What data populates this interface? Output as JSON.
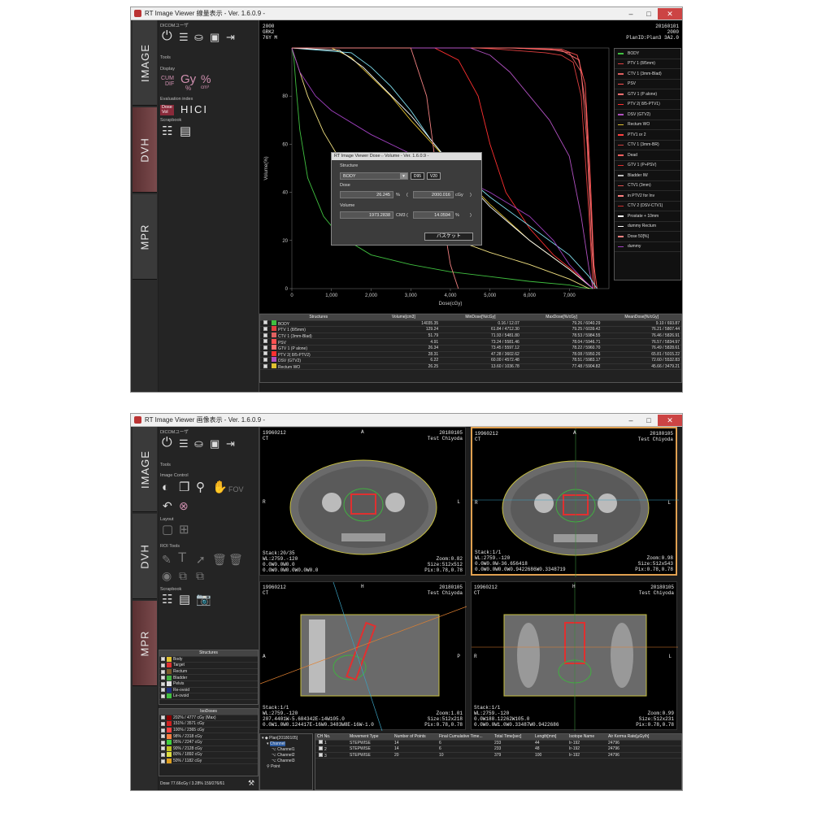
{
  "dvh_window": {
    "title": "RT Image Viewer  線量表示 - Ver. 1.6.0.9 -",
    "tabs": [
      "IMAGE",
      "DVH",
      "MPR"
    ],
    "user_label": "DICOMユーザ",
    "sections": {
      "tools": "Tools",
      "display": "Display",
      "evaluation": "Evaluation index",
      "scrapbook": "Scrapbook"
    },
    "display_icons": {
      "cum": "CUM",
      "dif": "DIF",
      "gy": "Gy",
      "pct": "%",
      "cm3": "cm³",
      "vol": "%"
    },
    "eval_icons": {
      "dose": "Dose",
      "vol": "Vol",
      "hi": "HI",
      "ci": "CI"
    },
    "chart_header": {
      "left": [
        "2000",
        "GRK2",
        "76Y M"
      ],
      "right": [
        "20160101",
        "2000",
        "PlanID:Plan3 3A2.0"
      ]
    },
    "legend": [
      {
        "name": "BODY",
        "color": "#40c040"
      },
      {
        "name": "PTV 1 (8/5mm)",
        "color": "#e04040"
      },
      {
        "name": "CTV 1 (3mm-Blad)",
        "color": "#e06060"
      },
      {
        "name": "PSV",
        "color": "#ff5050"
      },
      {
        "name": "GTV 1 (P alone)",
        "color": "#ff7070"
      },
      {
        "name": "PTV 2( 8/5-PTV1)",
        "color": "#ff3030"
      },
      {
        "name": "DSV (GTV2)",
        "color": "#b050c0"
      },
      {
        "name": "Rectum WO",
        "color": "#e0c030"
      },
      {
        "name": "PTV1 or 2",
        "color": "#ff4040"
      },
      {
        "name": "CTV 1 (3mm-BR)",
        "color": "#d04040"
      },
      {
        "name": "Dead",
        "color": "#ff6060"
      },
      {
        "name": "GTV 1 (P+PSV)",
        "color": "#e03030"
      },
      {
        "name": "Bladder IW",
        "color": "#c0c0c0"
      },
      {
        "name": "CTV1 (3mm)",
        "color": "#e05050"
      },
      {
        "name": "in PTV2 for Inv",
        "color": "#ff8080"
      },
      {
        "name": "CTV 2 (DSV-CTV1)",
        "color": "#d03030"
      },
      {
        "name": "Prostate + 10mm",
        "color": "#ffffff"
      },
      {
        "name": "dummy Rectum",
        "color": "#ffffff"
      },
      {
        "name": "Dose 50[%]",
        "color": "#f08080"
      },
      {
        "name": "dummy",
        "color": "#a040c0"
      }
    ],
    "dialog": {
      "title": "RT Image Viewer  Dose⇔Volume - Ver. 1.6.0.9 -",
      "structure_label": "Structure",
      "structure_value": "BODY",
      "btn_d95": "D95",
      "btn_v20": "V20",
      "dose_label": "Dose",
      "dose_pct": "26.245",
      "dose_pct_unit": "%",
      "dose_cgy": "2000.016",
      "dose_cgy_unit": "cGy",
      "volume_label": "Volume",
      "volume_cm3": "1973.2838",
      "volume_cm3_unit": "CM3",
      "volume_pct": "14.0594",
      "volume_pct_unit": "%",
      "basket_button": "バスケット"
    },
    "table": {
      "headers": [
        "Structures",
        "Volume[cm3]",
        "MinDose[%/cGy]",
        "MaxDose[%/cGy]",
        "MeanDose[%/cGy]"
      ],
      "rows": [
        {
          "name": "BODY",
          "color": "#40c040",
          "vol": "14035.35",
          "min": "0.16 / 12.07",
          "max": "79.26 / 6040.29",
          "mean": "9.10 / 693.87"
        },
        {
          "name": "PTV 1 (8/5mm)",
          "color": "#e04040",
          "vol": "129.24",
          "min": "61.84 / 4712.30",
          "max": "79.25 / 6039.42",
          "mean": "76.21 / 5807.44"
        },
        {
          "name": "CTV 1 (3mm-Blad)",
          "color": "#e06060",
          "vol": "51.79",
          "min": "71.93 / 5481.80",
          "max": "78.53 / 5984.55",
          "mean": "76.46 / 5826.91"
        },
        {
          "name": "PSV",
          "color": "#ff5050",
          "vol": "4.91",
          "min": "73.24 / 5581.46",
          "max": "78.04 / 5946.71",
          "mean": "76.57 / 5834.97"
        },
        {
          "name": "GTV 1 (P alone)",
          "color": "#ff7070",
          "vol": "26.34",
          "min": "73.45 / 5597.12",
          "max": "78.22 / 5960.70",
          "mean": "76.49 / 5828.61"
        },
        {
          "name": "PTV 2( 8/5-PTV2)",
          "color": "#ff3030",
          "vol": "28.31",
          "min": "47.28 / 3602.62",
          "max": "78.08 / 5950.26",
          "mean": "65.81 / 5015.22"
        },
        {
          "name": "DSV (GTV2)",
          "color": "#b050c0",
          "vol": "6.22",
          "min": "60.00 / 4572.48",
          "max": "78.51 / 5983.17",
          "mean": "72.60 / 5532.83"
        },
        {
          "name": "Rectum WO",
          "color": "#e0c030",
          "vol": "26.25",
          "min": "13.60 / 1036.78",
          "max": "77.48 / 5904.82",
          "mean": "45.66 / 3479.21"
        }
      ]
    },
    "chart_data": {
      "type": "line",
      "xlabel": "Dose(cGy)",
      "ylabel": "Volume(%)",
      "xlim": [
        0,
        8000
      ],
      "ylim": [
        0,
        100
      ],
      "xticks": [
        "0",
        "1,000",
        "2,000",
        "3,000",
        "4,000",
        "5,000",
        "6,000",
        "7,000"
      ],
      "yticks": [
        "0",
        "20",
        "40",
        "60",
        "80"
      ],
      "series": [
        {
          "name": "BODY",
          "color": "#40c040",
          "x": [
            0,
            50,
            100,
            200,
            400,
            800,
            1200,
            2000,
            3000,
            4000,
            5000,
            6000,
            7000,
            7300,
            7600
          ],
          "y": [
            100,
            96,
            85,
            66,
            46,
            30,
            22,
            14,
            10,
            7,
            5,
            3,
            1.5,
            0.5,
            0
          ]
        },
        {
          "name": "PTV 1 (8/5mm)",
          "color": "#e04040",
          "x": [
            0,
            4700,
            5200,
            5600,
            6000,
            6400,
            6800,
            7100,
            7300,
            7500,
            7600
          ],
          "y": [
            100,
            100,
            99.5,
            99,
            98.5,
            98,
            97,
            94,
            80,
            30,
            0
          ]
        },
        {
          "name": "CTV 1 (3mm-Blad)",
          "color": "#e06060",
          "x": [
            0,
            5500,
            6500,
            7000,
            7300,
            7450,
            7550,
            7650
          ],
          "y": [
            100,
            100,
            99.5,
            98,
            90,
            60,
            20,
            0
          ]
        },
        {
          "name": "PSV",
          "color": "#ff5050",
          "x": [
            0,
            5600,
            6800,
            7200,
            7400,
            7520,
            7620,
            7700
          ],
          "y": [
            100,
            100,
            99.5,
            97,
            85,
            50,
            10,
            0
          ]
        },
        {
          "name": "GTV 1 (P alone)",
          "color": "#ff7070",
          "x": [
            0,
            5600,
            6800,
            7250,
            7420,
            7540,
            7640
          ],
          "y": [
            100,
            100,
            99,
            95,
            75,
            35,
            0
          ]
        },
        {
          "name": "PTV 2( 8/5-PTV2)",
          "color": "#ff3030",
          "x": [
            0,
            3600,
            4200,
            4700,
            5000,
            5400,
            6000,
            6600,
            7200,
            7600
          ],
          "y": [
            100,
            100,
            95,
            80,
            60,
            40,
            25,
            14,
            6,
            0
          ]
        },
        {
          "name": "DSV (GTV2)",
          "color": "#b050c0",
          "x": [
            0,
            4500,
            5000,
            5500,
            6000,
            6500,
            7000,
            7300,
            7500,
            7600
          ],
          "y": [
            100,
            100,
            97,
            90,
            80,
            70,
            55,
            30,
            8,
            0
          ]
        },
        {
          "name": "Rectum WO",
          "color": "#e0c030",
          "x": [
            0,
            1000,
            1500,
            2000,
            2500,
            3000,
            4000,
            5000,
            6000,
            7000,
            7600
          ],
          "y": [
            100,
            100,
            96,
            88,
            80,
            70,
            52,
            35,
            20,
            8,
            0
          ]
        },
        {
          "name": "Bladder IW",
          "color": "#80e0f0",
          "x": [
            0,
            1500,
            2000,
            2500,
            3000,
            3500,
            4000,
            5000,
            6000,
            7000,
            7500,
            7700
          ],
          "y": [
            100,
            98,
            92,
            84,
            74,
            62,
            52,
            38,
            26,
            14,
            5,
            0
          ]
        },
        {
          "name": "Prostate + 10mm",
          "color": "#ffffff",
          "x": [
            0,
            1200,
            1800,
            2400,
            3000,
            3600,
            4200,
            5000,
            6000,
            7000,
            7600
          ],
          "y": [
            100,
            99,
            92,
            82,
            72,
            60,
            48,
            34,
            20,
            8,
            0
          ]
        },
        {
          "name": "dummy Rectum",
          "color": "#f0e080",
          "x": [
            0,
            400,
            800,
            1200,
            1600,
            2000,
            2500,
            3000,
            4000,
            5000,
            6000,
            7000,
            7500
          ],
          "y": [
            100,
            80,
            65,
            54,
            46,
            40,
            34,
            29,
            21,
            15,
            10,
            4,
            0
          ]
        },
        {
          "name": "dummy",
          "color": "#a040c0",
          "x": [
            0,
            200,
            600,
            1000,
            2000,
            3000,
            4000,
            5000,
            6000,
            6600,
            7000,
            7400,
            7600
          ],
          "y": [
            100,
            90,
            80,
            74,
            64,
            56,
            48,
            40,
            30,
            20,
            10,
            3,
            0
          ]
        },
        {
          "name": "Dose 50[%]",
          "color": "#f08080",
          "x": [
            0,
            3000,
            3400,
            3800,
            4000,
            4200
          ],
          "y": [
            100,
            100,
            80,
            30,
            10,
            0
          ]
        }
      ]
    }
  },
  "mpr_window": {
    "title": "RT Image Viewer  画像表示 - Ver. 1.6.0.9 -",
    "tabs": [
      "IMAGE",
      "DVH",
      "MPR"
    ],
    "user_label": "DICOMユーザ",
    "sections": {
      "tools": "Tools",
      "image_control": "Image Control",
      "layout": "Layout",
      "roi_tools": "ROI Tools",
      "scrapbook": "Scrapbook"
    },
    "fov_label": "FOV",
    "views": [
      {
        "tl": "19960212\nCT",
        "tr": "20180105\nTest Chiyoda",
        "top": "A",
        "left": "R",
        "right": "L",
        "bl": "Stack:20/35\nWL:2759.-120\n0.0W0.0W0.0\n0.0W0.0W0.0W0.0W0.0",
        "br": "Zoom:0.82\nSize:512x512\nPix:0.78,0.78"
      },
      {
        "tl": "19960212\nCT",
        "tr": "20180105\nTest Chiyoda",
        "top": "A",
        "left": "R",
        "right": "L",
        "bl": "Stack:1/1\nWL:2759.-120\n0.0W0.0W-36.656418\n0.0W0.0W0.0W0.9422686W0.3348719",
        "br": "Zoom:0.98\nSize:512x543\nPix:0.78,0.78"
      },
      {
        "tl": "19960212\nCT",
        "tr": "20180105\nTest Chiyoda",
        "top": "H",
        "left": "A",
        "right": "P",
        "bl": "Stack:1/1\nWL:2759.-120\n207.4401W-5.684342E-14W105.0\n0.0W1.0W0.124417E-16W0.3483W8E-16W-1.0",
        "br": "Zoom:1.01\nSize:512x218\nPix:0.78,0.78"
      },
      {
        "tl": "19960212\nCT",
        "tr": "20180105\nTest Chiyoda",
        "top": "H",
        "left": "R",
        "right": "L",
        "bl": "Stack:1/1\nWL:2759.-120\n0.0W188.12262W105.0\n0.0W0.0W1.0W0.33487W0.9422686",
        "br": "Zoom:0.99\nSize:512x231\nPix:0.78,0.78"
      }
    ],
    "structures": {
      "header": "Structures",
      "items": [
        {
          "name": "Body",
          "color": "#e0c030"
        },
        {
          "name": "Target",
          "color": "#e03030"
        },
        {
          "name": "Rectum",
          "color": "#7a5a2a"
        },
        {
          "name": "Bladder",
          "color": "#40b040"
        },
        {
          "name": "Pelvis",
          "color": "#e0e0e0"
        },
        {
          "name": "Re-ovoid",
          "color": "#203080"
        },
        {
          "name": "Le-ovoid",
          "color": "#40c040"
        }
      ]
    },
    "isodoses": {
      "header": "IsoDoses",
      "items": [
        {
          "label": "202% / 4777 cGy (Max)",
          "color": "#8b0000"
        },
        {
          "label": "151% / 3571 cGy",
          "color": "#d02020"
        },
        {
          "label": "100% / 2365 cGy",
          "color": "#ff4040"
        },
        {
          "label": "98% / 2318 cGy",
          "color": "#ff8040"
        },
        {
          "label": "95% / 2247 cGy",
          "color": "#40d040"
        },
        {
          "label": "90% / 2128 cGy",
          "color": "#c0c020"
        },
        {
          "label": "80% / 1892 cGy",
          "color": "#e0e040"
        },
        {
          "label": "50% / 1182 cGy",
          "color": "#e0a020"
        }
      ]
    },
    "status": "Dose 77.66cGy / 3.28%  159/276/61",
    "plan_tree": {
      "plan": "Plan[20180105]",
      "channel": "Channel",
      "channels": [
        "Channel1",
        "Channel2",
        "Channel3"
      ],
      "point": "Point"
    },
    "channel_table": {
      "headers": [
        "CH No.",
        "Movement Type",
        "Number of Points",
        "Final Cumulative Time...",
        "Total Time[sec]",
        "Length[mm]",
        "Isotope Name",
        "Air Kerma Rate[μGy/h]"
      ],
      "rows": [
        [
          "1",
          "STEPWISE",
          "14",
          "6",
          "233",
          "44",
          "Ir-192",
          "24796"
        ],
        [
          "2",
          "STEPWISE",
          "14",
          "6",
          "233",
          "48",
          "Ir-192",
          "24796"
        ],
        [
          "3",
          "STEPWISE",
          "20",
          "10",
          "379",
          "100",
          "Ir-192",
          "24796"
        ]
      ]
    }
  }
}
